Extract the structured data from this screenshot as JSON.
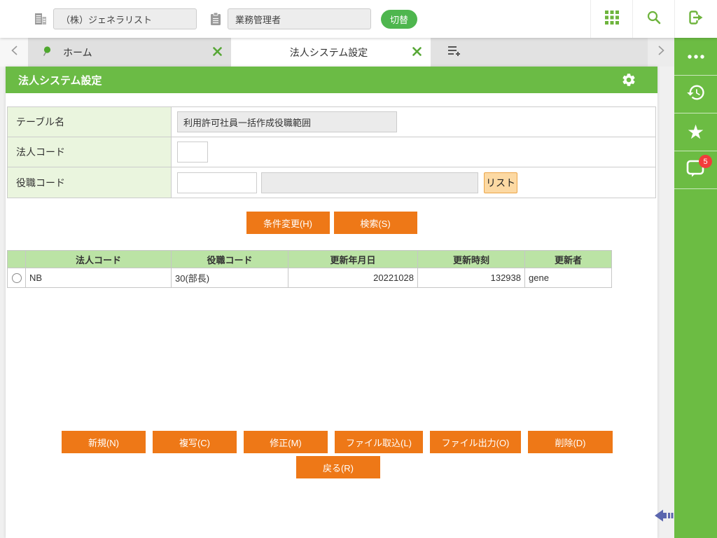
{
  "topbar": {
    "company_value": "（株）ジェネラリスト",
    "role_value": "業務管理者",
    "switch_label": "切替"
  },
  "tabbar": {
    "home_label": "ホーム",
    "active_label": "法人システム設定"
  },
  "panel": {
    "title": "法人システム設定"
  },
  "form": {
    "table_name_label": "テーブル名",
    "table_name_value": "利用許可社員一括作成役職範囲",
    "corp_code_label": "法人コード",
    "corp_code_value": "",
    "role_code_label": "役職コード",
    "role_code_value": "",
    "role_code_name_value": "",
    "list_button_label": "リスト"
  },
  "search": {
    "condition_label": "条件変更(H)",
    "search_label": "検索(S)"
  },
  "results": {
    "headers": {
      "corp": "法人コード",
      "role": "役職コード",
      "date": "更新年月日",
      "time": "更新時刻",
      "user": "更新者"
    },
    "row": {
      "corp": "NB",
      "role": "30(部長)",
      "date": "20221028",
      "time": "132938",
      "user": "gene"
    }
  },
  "actions": {
    "new": "新規(N)",
    "copy": "複写(C)",
    "modify": "修正(M)",
    "file_import": "ファイル取込(L)",
    "file_export": "ファイル出力(O)",
    "delete": "削除(D)",
    "back": "戻る(R)"
  },
  "sidebar": {
    "notification_count": "5"
  },
  "colors": {
    "brand_green": "#6cbc43",
    "accent_orange": "#ee7817",
    "table_header_green": "#bbe3a5",
    "form_label_green": "#eaf5de",
    "list_button_bg": "#fcd9a3",
    "badge_red": "#f23b3b",
    "collapse_arrow_blue": "#5b66ae"
  }
}
